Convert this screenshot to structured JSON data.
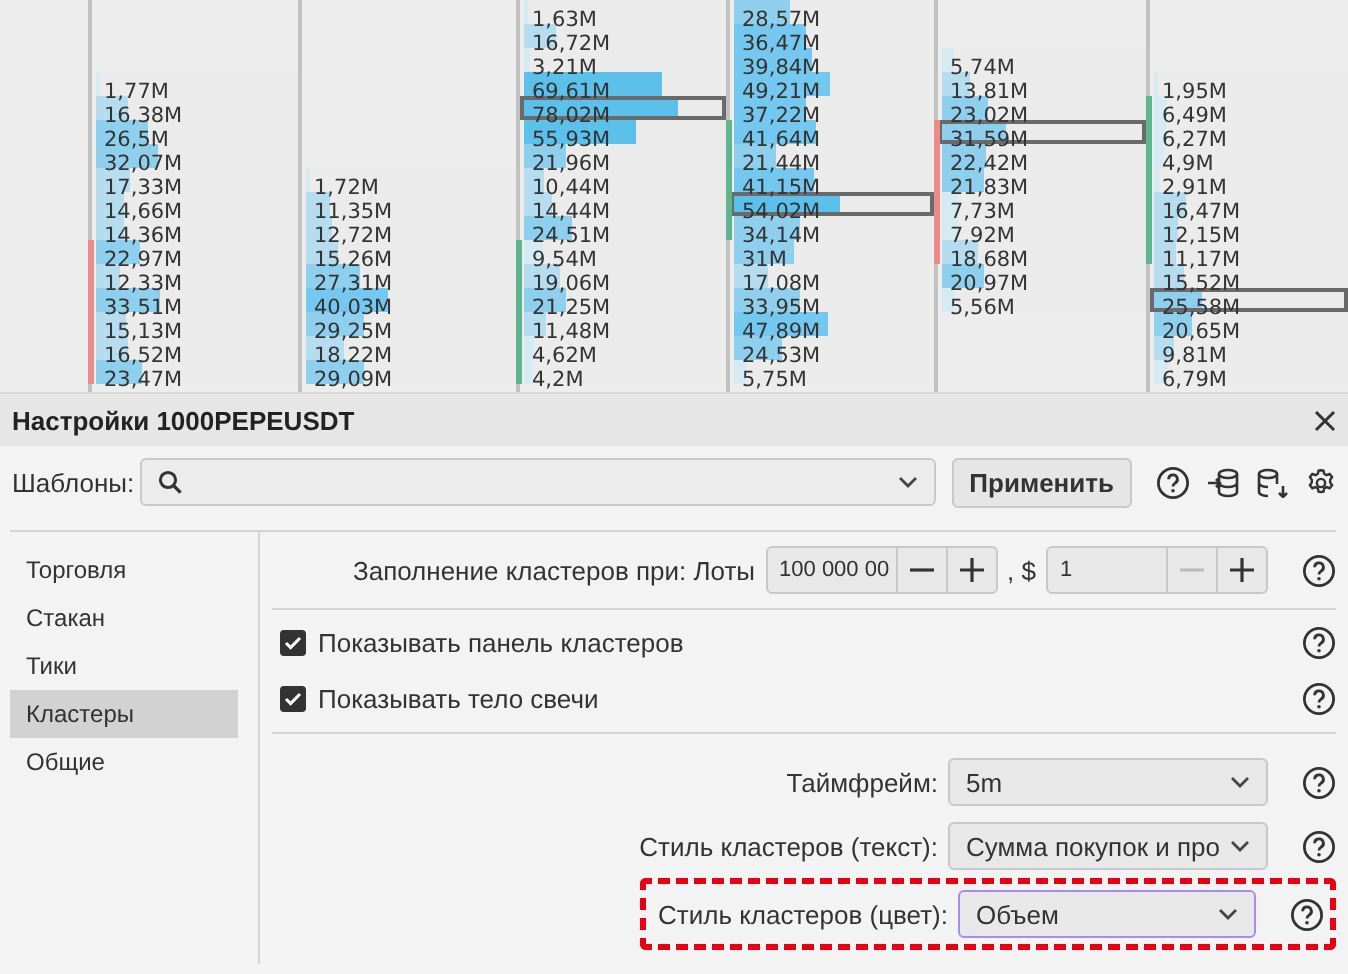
{
  "chart": {
    "columns": [
      {
        "color": "#ee8a8a",
        "cells": [
          {
            "value": "1,77M",
            "level": 0.02,
            "max": false,
            "body": false
          },
          {
            "value": "16,38M",
            "level": 0.16,
            "max": false,
            "body": false
          },
          {
            "value": "26,5M",
            "level": 0.26,
            "max": false,
            "body": false
          },
          {
            "value": "32,07M",
            "level": 0.31,
            "max": false,
            "body": false
          },
          {
            "value": "17,33M",
            "level": 0.17,
            "max": false,
            "body": false
          },
          {
            "value": "14,66M",
            "level": 0.14,
            "max": false,
            "body": false
          },
          {
            "value": "14,36M",
            "level": 0.14,
            "max": false,
            "body": false
          },
          {
            "value": "22,97M",
            "level": 0.22,
            "max": false,
            "body": true
          },
          {
            "value": "12,33M",
            "level": 0.12,
            "max": false,
            "body": true
          },
          {
            "value": "33,51M",
            "level": 0.32,
            "max": false,
            "body": true
          },
          {
            "value": "15,13M",
            "level": 0.15,
            "max": false,
            "body": true
          },
          {
            "value": "16,52M",
            "level": 0.16,
            "max": false,
            "body": true
          },
          {
            "value": "23,47M",
            "level": 0.23,
            "max": false,
            "body": true
          }
        ]
      },
      {
        "cells": [
          {
            "value": "1,72M",
            "level": 0.02,
            "max": false,
            "body": false
          },
          {
            "value": "11,35M",
            "level": 0.11,
            "max": false,
            "body": false
          },
          {
            "value": "12,72M",
            "level": 0.12,
            "max": false,
            "body": false
          },
          {
            "value": "15,26M",
            "level": 0.15,
            "max": false,
            "body": false
          },
          {
            "value": "27,31M",
            "level": 0.26,
            "max": false,
            "body": false
          },
          {
            "value": "40,03M",
            "level": 0.39,
            "max": false,
            "body": false
          },
          {
            "value": "29,25M",
            "level": 0.28,
            "max": false,
            "body": false
          },
          {
            "value": "18,22M",
            "level": 0.18,
            "max": false,
            "body": false
          },
          {
            "value": "29,09M",
            "level": 0.28,
            "max": false,
            "body": false
          }
        ]
      },
      {
        "color": "#5fb58f",
        "cells": [
          {
            "value": "1,63M",
            "level": 0.02,
            "max": false,
            "body": false
          },
          {
            "value": "16,72M",
            "level": 0.16,
            "max": false,
            "body": false
          },
          {
            "value": "3,21M",
            "level": 0.03,
            "max": false,
            "body": false
          },
          {
            "value": "69,61M",
            "level": 0.68,
            "max": false,
            "body": false
          },
          {
            "value": "78,02M",
            "level": 0.76,
            "max": true,
            "body": false
          },
          {
            "value": "55,93M",
            "level": 0.55,
            "max": false,
            "body": false
          },
          {
            "value": "21,96M",
            "level": 0.21,
            "max": false,
            "body": false
          },
          {
            "value": "10,44M",
            "level": 0.1,
            "max": false,
            "body": false
          },
          {
            "value": "14,44M",
            "level": 0.14,
            "max": false,
            "body": false
          },
          {
            "value": "24,51M",
            "level": 0.24,
            "max": false,
            "body": false
          },
          {
            "value": "9,54M",
            "level": 0.09,
            "max": false,
            "body": true
          },
          {
            "value": "19,06M",
            "level": 0.18,
            "max": false,
            "body": true
          },
          {
            "value": "21,25M",
            "level": 0.21,
            "max": false,
            "body": true
          },
          {
            "value": "11,48M",
            "level": 0.11,
            "max": false,
            "body": true
          },
          {
            "value": "4,62M",
            "level": 0.05,
            "max": false,
            "body": true
          },
          {
            "value": "4,2M",
            "level": 0.04,
            "max": false,
            "body": true
          }
        ]
      },
      {
        "color": "#5fb58f",
        "cells": [
          {
            "value": "28,57M",
            "level": 0.28,
            "max": false,
            "body": false
          },
          {
            "value": "36,47M",
            "level": 0.36,
            "max": false,
            "body": false
          },
          {
            "value": "39,84M",
            "level": 0.39,
            "max": false,
            "body": false
          },
          {
            "value": "49,21M",
            "level": 0.48,
            "max": false,
            "body": false
          },
          {
            "value": "37,22M",
            "level": 0.36,
            "max": false,
            "body": false
          },
          {
            "value": "41,64M",
            "level": 0.41,
            "max": false,
            "body": true
          },
          {
            "value": "21,44M",
            "level": 0.21,
            "max": false,
            "body": true
          },
          {
            "value": "41,15M",
            "level": 0.4,
            "max": false,
            "body": true
          },
          {
            "value": "54,02M",
            "level": 0.53,
            "max": true,
            "body": true
          },
          {
            "value": "34,14M",
            "level": 0.33,
            "max": false,
            "body": true
          },
          {
            "value": "31M",
            "level": 0.3,
            "max": false,
            "body": false
          },
          {
            "value": "17,08M",
            "level": 0.17,
            "max": false,
            "body": false
          },
          {
            "value": "33,95M",
            "level": 0.33,
            "max": false,
            "body": false
          },
          {
            "value": "47,89M",
            "level": 0.47,
            "max": false,
            "body": false
          },
          {
            "value": "24,53M",
            "level": 0.24,
            "max": false,
            "body": false
          },
          {
            "value": "5,75M",
            "level": 0.06,
            "max": false,
            "body": false
          }
        ]
      },
      {
        "color": "#ee8a8a",
        "cells": [
          {
            "value": "5,74M",
            "level": 0.06,
            "max": false,
            "body": false
          },
          {
            "value": "13,81M",
            "level": 0.14,
            "max": false,
            "body": false
          },
          {
            "value": "23,02M",
            "level": 0.23,
            "max": false,
            "body": false
          },
          {
            "value": "31,59M",
            "level": 0.31,
            "max": true,
            "body": true
          },
          {
            "value": "22,42M",
            "level": 0.22,
            "max": false,
            "body": true
          },
          {
            "value": "21,83M",
            "level": 0.21,
            "max": false,
            "body": true
          },
          {
            "value": "7,73M",
            "level": 0.08,
            "max": false,
            "body": true
          },
          {
            "value": "7,92M",
            "level": 0.08,
            "max": false,
            "body": true
          },
          {
            "value": "18,68M",
            "level": 0.18,
            "max": false,
            "body": true
          },
          {
            "value": "20,97M",
            "level": 0.21,
            "max": false,
            "body": false
          },
          {
            "value": "5,56M",
            "level": 0.06,
            "max": false,
            "body": false
          }
        ]
      },
      {
        "color": "#5fb58f",
        "cells": [
          {
            "value": "1,95M",
            "level": 0.02,
            "max": false,
            "body": false
          },
          {
            "value": "6,49M",
            "level": 0.06,
            "max": false,
            "body": true
          },
          {
            "value": "6,27M",
            "level": 0.06,
            "max": false,
            "body": true
          },
          {
            "value": "4,9M",
            "level": 0.05,
            "max": false,
            "body": true
          },
          {
            "value": "2,91M",
            "level": 0.03,
            "max": false,
            "body": true
          },
          {
            "value": "16,47M",
            "level": 0.16,
            "max": false,
            "body": true
          },
          {
            "value": "12,15M",
            "level": 0.12,
            "max": false,
            "body": true
          },
          {
            "value": "11,17M",
            "level": 0.11,
            "max": false,
            "body": true
          },
          {
            "value": "15,52M",
            "level": 0.15,
            "max": false,
            "body": false
          },
          {
            "value": "25,58M",
            "level": 0.25,
            "max": true,
            "body": false
          },
          {
            "value": "20,65M",
            "level": 0.2,
            "max": false,
            "body": false
          },
          {
            "value": "9,81M",
            "level": 0.1,
            "max": false,
            "body": false
          },
          {
            "value": "6,79M",
            "level": 0.07,
            "max": false,
            "body": false
          }
        ]
      }
    ]
  },
  "dialog": {
    "title": "Настройки 1000PEPEUSDT",
    "templates": {
      "label": "Шаблоны:"
    },
    "apply_button": "Применить",
    "nav": [
      {
        "label": "Торговля",
        "selected": false
      },
      {
        "label": "Стакан",
        "selected": false
      },
      {
        "label": "Тики",
        "selected": false
      },
      {
        "label": "Кластеры",
        "selected": true
      },
      {
        "label": "Общие",
        "selected": false
      }
    ],
    "fill_row": {
      "label": "Заполнение кластеров при: Лоты",
      "lots": {
        "value": "100 000 00",
        "decrement_disabled": false
      },
      "separator": ", $",
      "price": {
        "value": "1",
        "decrement_disabled": true
      }
    },
    "checkboxes": [
      {
        "label": "Показывать панель кластеров",
        "checked": true
      },
      {
        "label": "Показывать тело свечи",
        "checked": true
      }
    ],
    "selects": [
      {
        "label": "Таймфрейм:",
        "value": "5m",
        "focused": false,
        "highlighted": false
      },
      {
        "label": "Стиль кластеров (текст):",
        "value": "Сумма покупок и про",
        "focused": false,
        "highlighted": false
      },
      {
        "label": "Стиль кластеров (цвет):",
        "value": "Объем",
        "focused": true,
        "highlighted": true
      }
    ]
  }
}
